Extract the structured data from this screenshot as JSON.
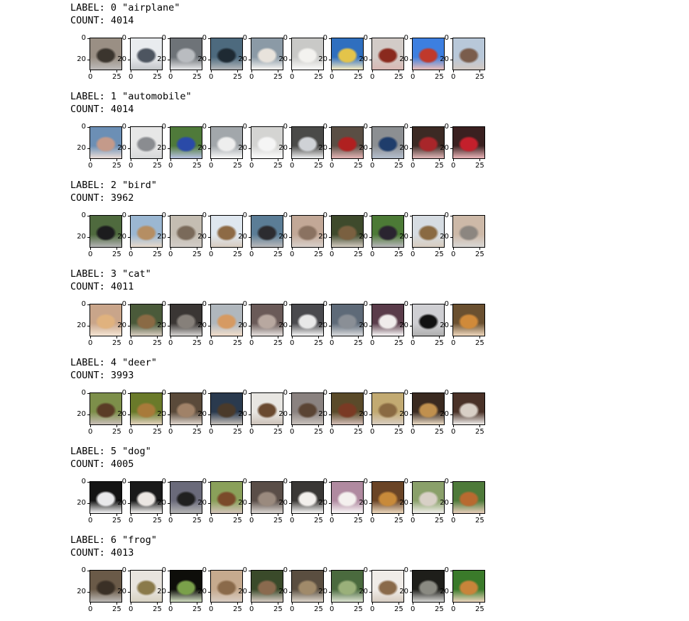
{
  "classes": [
    {
      "label_text": "LABEL: 0 \"airplane\"",
      "count_text": "COUNT: 4014",
      "thumbs": [
        {
          "bg": "#9a8f84",
          "fg": "#3b352e"
        },
        {
          "bg": "#e9ecef",
          "fg": "#4d5560"
        },
        {
          "bg": "#6e7378",
          "fg": "#b9bcc0"
        },
        {
          "bg": "#4d6a7e",
          "fg": "#1e2a33"
        },
        {
          "bg": "#8b9aa6",
          "fg": "#e8e3dc"
        },
        {
          "bg": "#c9c9c7",
          "fg": "#f3f2ef"
        },
        {
          "bg": "#2f6fbf",
          "fg": "#e3c44a"
        },
        {
          "bg": "#d2cbc7",
          "fg": "#8a2a1e"
        },
        {
          "bg": "#3d7fe0",
          "fg": "#c0392b"
        },
        {
          "bg": "#b8c8d9",
          "fg": "#7a5d4c"
        }
      ],
      "x_ticks": [
        "0",
        "25"
      ],
      "y_ticks": [
        "0",
        "20"
      ]
    },
    {
      "label_text": "LABEL: 1 \"automobile\"",
      "count_text": "COUNT: 4014",
      "thumbs": [
        {
          "bg": "#6c8fb5",
          "fg": "#c49a8a"
        },
        {
          "bg": "#e7e7e7",
          "fg": "#8a8c90"
        },
        {
          "bg": "#4f7a3a",
          "fg": "#2a4aa8"
        },
        {
          "bg": "#a2a7ab",
          "fg": "#eeeeee"
        },
        {
          "bg": "#d4d4d2",
          "fg": "#f5f5f5"
        },
        {
          "bg": "#4a4a48",
          "fg": "#cfd2d6"
        },
        {
          "bg": "#5a4e44",
          "fg": "#b02020"
        },
        {
          "bg": "#8c8f92",
          "fg": "#1f3d6b"
        },
        {
          "bg": "#3c2a24",
          "fg": "#a8262a"
        },
        {
          "bg": "#3a2020",
          "fg": "#c4202c"
        }
      ],
      "x_ticks": [
        "0",
        "25"
      ],
      "y_ticks": [
        "0",
        "20"
      ]
    },
    {
      "label_text": "LABEL: 2 \"bird\"",
      "count_text": "COUNT: 3962",
      "thumbs": [
        {
          "bg": "#4f6a3e",
          "fg": "#1c1c1e"
        },
        {
          "bg": "#9bb7d2",
          "fg": "#b58e63"
        },
        {
          "bg": "#c4bdb2",
          "fg": "#7a6a5a"
        },
        {
          "bg": "#dfe7ef",
          "fg": "#8d6a45"
        },
        {
          "bg": "#5b7d96",
          "fg": "#2c2c30"
        },
        {
          "bg": "#c2a897",
          "fg": "#8a7261"
        },
        {
          "bg": "#3e4a2c",
          "fg": "#7a6040"
        },
        {
          "bg": "#4c7a36",
          "fg": "#2a2430"
        },
        {
          "bg": "#d6dce2",
          "fg": "#8a6a42"
        },
        {
          "bg": "#cdb9a8",
          "fg": "#8c8680"
        }
      ],
      "x_ticks": [
        "0",
        "25"
      ],
      "y_ticks": [
        "0",
        "20"
      ]
    },
    {
      "label_text": "LABEL: 3 \"cat\"",
      "count_text": "COUNT: 4011",
      "thumbs": [
        {
          "bg": "#c9a58a",
          "fg": "#e0b27e"
        },
        {
          "bg": "#4a5a3a",
          "fg": "#8a6a44"
        },
        {
          "bg": "#3a3634",
          "fg": "#86807a"
        },
        {
          "bg": "#b0b7bd",
          "fg": "#d69a62"
        },
        {
          "bg": "#6a5a58",
          "fg": "#b8a8a0"
        },
        {
          "bg": "#4a4a4e",
          "fg": "#e8e8e8"
        },
        {
          "bg": "#5e6a78",
          "fg": "#8a8f96"
        },
        {
          "bg": "#5a3c4a",
          "fg": "#f0eceb"
        },
        {
          "bg": "#cfcfd3",
          "fg": "#121212"
        },
        {
          "bg": "#6a5030",
          "fg": "#d08a3a"
        }
      ],
      "x_ticks": [
        "0",
        "25"
      ],
      "y_ticks": [
        "0",
        "20"
      ]
    },
    {
      "label_text": "LABEL: 4 \"deer\"",
      "count_text": "COUNT: 3993",
      "thumbs": [
        {
          "bg": "#7d8f4a",
          "fg": "#5a3c26"
        },
        {
          "bg": "#6a7a2a",
          "fg": "#a87a3a"
        },
        {
          "bg": "#5a4a3a",
          "fg": "#a08268"
        },
        {
          "bg": "#2a3a4e",
          "fg": "#4a3a2a"
        },
        {
          "bg": "#e8e6e2",
          "fg": "#6a4a30"
        },
        {
          "bg": "#8a8280",
          "fg": "#5a4434"
        },
        {
          "bg": "#5a4a2a",
          "fg": "#7a3a24"
        },
        {
          "bg": "#c2aa72",
          "fg": "#8a6a42"
        },
        {
          "bg": "#3a2a20",
          "fg": "#c0904e"
        },
        {
          "bg": "#4a3228",
          "fg": "#d8cfc6"
        }
      ],
      "x_ticks": [
        "0",
        "25"
      ],
      "y_ticks": [
        "0",
        "20"
      ]
    },
    {
      "label_text": "LABEL: 5 \"dog\"",
      "count_text": "COUNT: 4005",
      "thumbs": [
        {
          "bg": "#141414",
          "fg": "#e8e8ea"
        },
        {
          "bg": "#1a1a1a",
          "fg": "#ebe6e2"
        },
        {
          "bg": "#6a6a7a",
          "fg": "#202020"
        },
        {
          "bg": "#8aa05a",
          "fg": "#7a4a2a"
        },
        {
          "bg": "#5a4e48",
          "fg": "#9a8a7e"
        },
        {
          "bg": "#3a3836",
          "fg": "#f2efec"
        },
        {
          "bg": "#b08aa0",
          "fg": "#f4f0ee"
        },
        {
          "bg": "#6a4426",
          "fg": "#c88a3a"
        },
        {
          "bg": "#8aa06a",
          "fg": "#d8d0c6"
        },
        {
          "bg": "#4e7a3a",
          "fg": "#b86a30"
        }
      ],
      "x_ticks": [
        "0",
        "25"
      ],
      "y_ticks": [
        "0",
        "20"
      ]
    },
    {
      "label_text": "LABEL: 6 \"frog\"",
      "count_text": "COUNT: 4013",
      "thumbs": [
        {
          "bg": "#6a5a48",
          "fg": "#3a3026"
        },
        {
          "bg": "#e8e4de",
          "fg": "#8a7a4a"
        },
        {
          "bg": "#0e0e0a",
          "fg": "#7aa04a"
        },
        {
          "bg": "#c6aa8e",
          "fg": "#8a6a4a"
        },
        {
          "bg": "#3a4a2a",
          "fg": "#8a6a4e"
        },
        {
          "bg": "#5a4e40",
          "fg": "#a08a6a"
        },
        {
          "bg": "#4a6a3e",
          "fg": "#9ab07a"
        },
        {
          "bg": "#f0ece8",
          "fg": "#8a6a4a"
        },
        {
          "bg": "#1e1e1a",
          "fg": "#8a8a82"
        },
        {
          "bg": "#3a7a2a",
          "fg": "#c8843a"
        }
      ],
      "x_ticks": [
        "0",
        "25"
      ],
      "y_ticks": [
        "0",
        "20"
      ]
    }
  ]
}
